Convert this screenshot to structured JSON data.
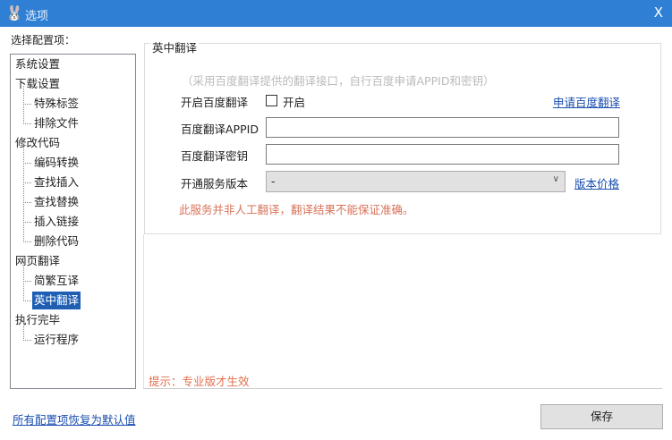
{
  "window": {
    "title": "选项",
    "close": "X"
  },
  "sidebar": {
    "label": "选择配置项：",
    "items": [
      {
        "label": "系统设置",
        "level": 0
      },
      {
        "label": "下载设置",
        "level": 0
      },
      {
        "label": "特殊标签",
        "level": 1
      },
      {
        "label": "排除文件",
        "level": 1
      },
      {
        "label": "修改代码",
        "level": 0
      },
      {
        "label": "编码转换",
        "level": 1
      },
      {
        "label": "查找插入",
        "level": 1
      },
      {
        "label": "查找替换",
        "level": 1
      },
      {
        "label": "插入链接",
        "level": 1
      },
      {
        "label": "删除代码",
        "level": 1
      },
      {
        "label": "网页翻译",
        "level": 0
      },
      {
        "label": "简繁互译",
        "level": 1
      },
      {
        "label": "英中翻译",
        "level": 1,
        "selected": true
      },
      {
        "label": "执行完毕",
        "level": 0
      },
      {
        "label": "运行程序",
        "level": 1
      }
    ]
  },
  "panel": {
    "title": "英中翻译",
    "note": "（采用百度翻译提供的翻译接口，自行百度申请APPID和密钥）",
    "enable_label": "开启百度翻译",
    "enable_checkbox": "开启",
    "enable_checked": false,
    "apply_link": "申请百度翻译",
    "appid_label": "百度翻译APPID",
    "appid_value": "",
    "key_label": "百度翻译密钥",
    "key_value": "",
    "version_label": "开通服务版本",
    "version_value": "-",
    "price_link": "版本价格",
    "warning": "此服务并非人工翻译，翻译结果不能保证准确。",
    "hint": "提示：专业版才生效"
  },
  "footer": {
    "reset_link": "所有配置项恢复为默认值",
    "save": "保存"
  }
}
